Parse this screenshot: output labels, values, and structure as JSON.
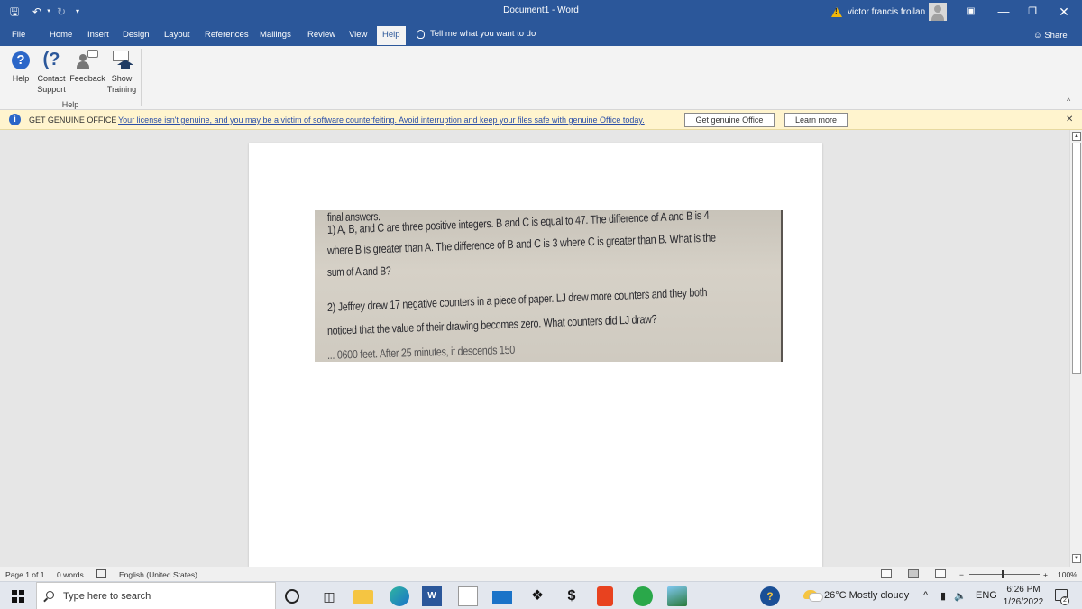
{
  "window": {
    "title": "Document1",
    "app": "Word",
    "user_name": "victor francis froilan"
  },
  "menu": {
    "items": [
      "File",
      "Home",
      "Insert",
      "Design",
      "Layout",
      "References",
      "Mailings",
      "Review",
      "View",
      "Help"
    ],
    "active": "Help",
    "tell_me": "Tell me what you want to do",
    "share": "Share"
  },
  "ribbon": {
    "buttons": [
      {
        "label": "Help",
        "icon": "help-icon"
      },
      {
        "label": "Contact Support",
        "line1": "Contact",
        "line2": "Support",
        "icon": "contact-support-icon"
      },
      {
        "label": "Feedback",
        "icon": "feedback-icon"
      },
      {
        "label": "Show Training",
        "line1": "Show",
        "line2": "Training",
        "icon": "training-icon"
      }
    ],
    "group_label": "Help"
  },
  "infobar": {
    "title": "GET GENUINE OFFICE",
    "message": "Your license isn't genuine, and you may be a victim of software counterfeiting. Avoid interruption and keep your files safe with genuine Office today.",
    "button_genuine": "Get genuine Office",
    "button_learn": "Learn more"
  },
  "document": {
    "image_lines": [
      "final answers.",
      "1) A, B, and C are three positive integers. B and C is equal to 47. The difference of A and B is 4",
      "where B is greater than A. The difference of B and C is 3 where C is greater than B. What is the",
      "sum of A and B?",
      "2) Jeffrey drew 17 negative counters in a piece of paper. LJ drew more counters and they both",
      "noticed that the value of their drawing becomes zero. What counters did LJ draw?",
      "... 0600 feet. After 25 minutes, it descends 150"
    ]
  },
  "status": {
    "page": "Page 1 of 1",
    "words": "0 words",
    "language": "English (United States)",
    "zoom_minus": "−",
    "zoom_plus": "+",
    "zoom": "100%"
  },
  "taskbar": {
    "search_placeholder": "Type here to search",
    "weather": "26°C  Mostly cloudy",
    "lang": "ENG",
    "time": "6:26 PM",
    "date": "1/26/2022",
    "notifications": "2"
  },
  "colors": {
    "word_blue": "#2b579a",
    "infobar_bg": "#fff4ce",
    "link_blue": "#2b4fa8"
  }
}
